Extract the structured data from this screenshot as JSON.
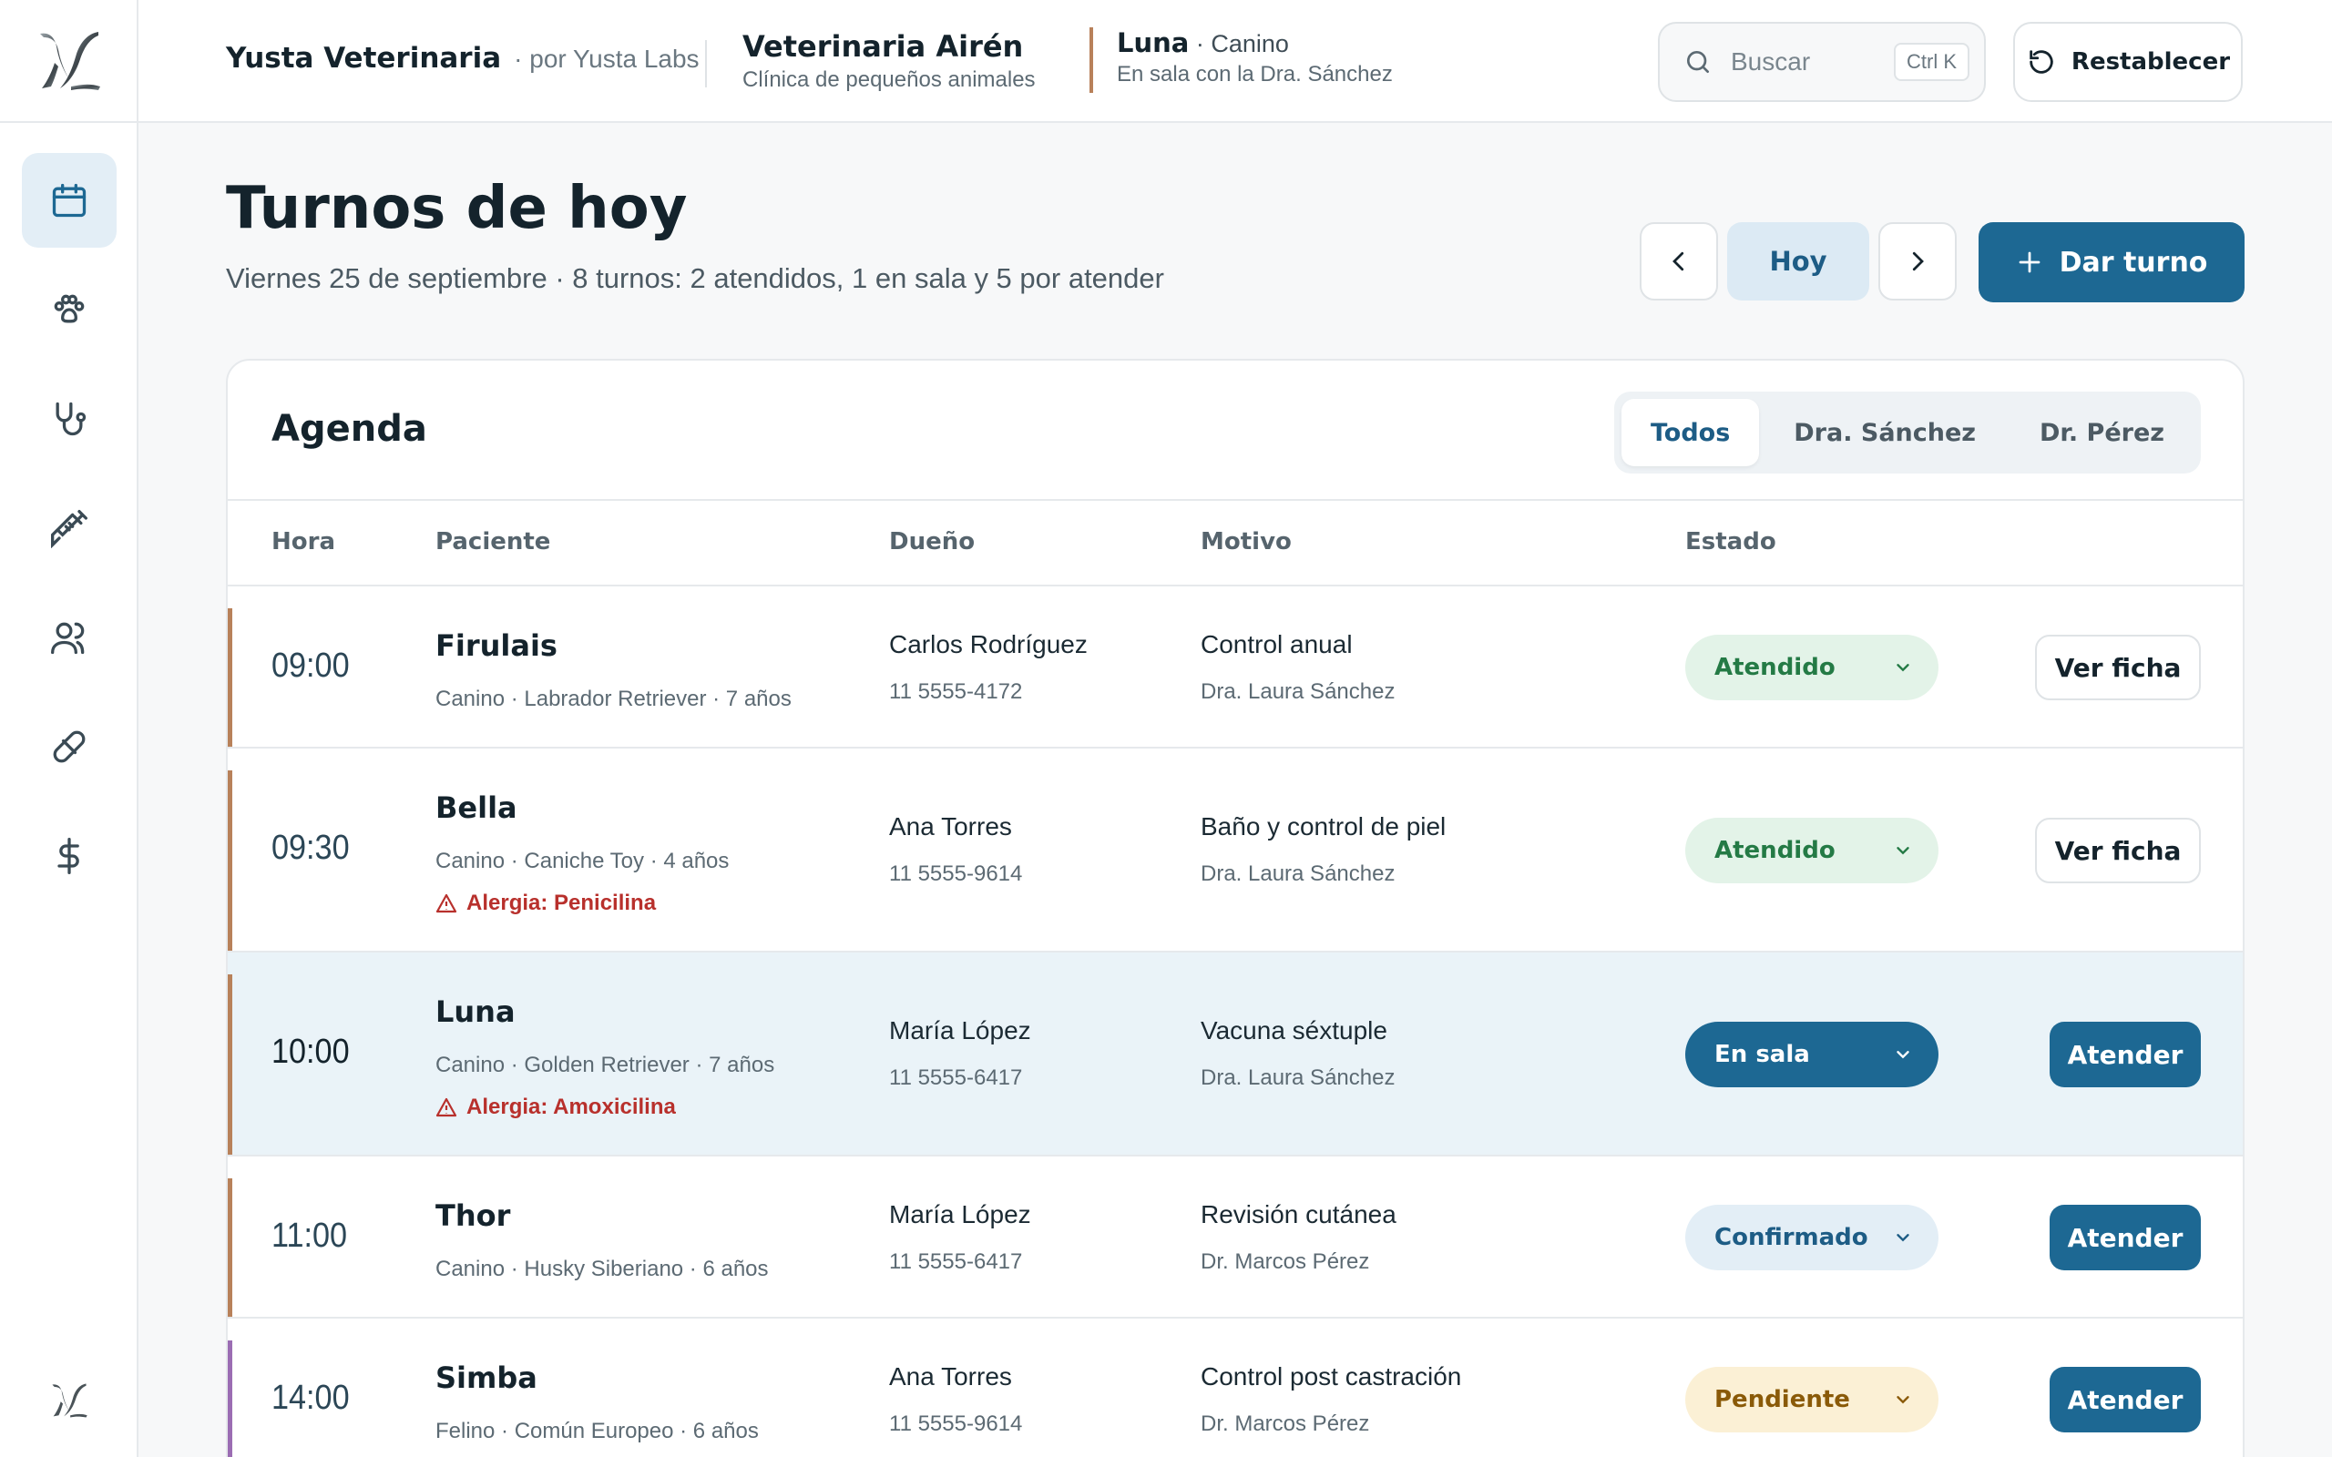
{
  "brand": {
    "name": "Yusta Veterinaria",
    "by": "· por Yusta Labs"
  },
  "clinic": {
    "name": "Veterinaria Airén",
    "subtitle": "Clínica de pequeños animales"
  },
  "current_patient": {
    "name": "Luna",
    "species": " · Canino",
    "status": "En sala con la Dra. Sánchez"
  },
  "search": {
    "placeholder": "Buscar",
    "shortcut": "Ctrl K"
  },
  "reset_label": "Restablecer",
  "sidebar": {
    "items": [
      {
        "icon": "calendar-icon",
        "active": true
      },
      {
        "icon": "paw-icon",
        "active": false
      },
      {
        "icon": "stethoscope-icon",
        "active": false
      },
      {
        "icon": "syringe-icon",
        "active": false
      },
      {
        "icon": "users-icon",
        "active": false
      },
      {
        "icon": "pill-icon",
        "active": false
      },
      {
        "icon": "dollar-icon",
        "active": false
      }
    ]
  },
  "page": {
    "title": "Turnos de hoy",
    "subtitle": "Viernes 25 de septiembre · 8 turnos: 2 atendidos, 1 en sala y 5 por atender",
    "today_label": "Hoy",
    "new_label": "Dar turno"
  },
  "agenda": {
    "title": "Agenda",
    "filters": [
      "Todos",
      "Dra. Sánchez",
      "Dr. Pérez"
    ],
    "active_filter": "Todos",
    "columns": [
      "Hora",
      "Paciente",
      "Dueño",
      "Motivo",
      "Estado"
    ],
    "rows": [
      {
        "time": "09:00",
        "patient": "Firulais",
        "detail": "Canino · Labrador Retriever · 7 años",
        "allergy": "",
        "owner": "Carlos Rodríguez",
        "phone": "11 5555-4172",
        "reason": "Control anual",
        "vet": "Dra. Laura Sánchez",
        "status": "Atendido",
        "action": "Ver ficha"
      },
      {
        "time": "09:30",
        "patient": "Bella",
        "detail": "Canino · Caniche Toy · 4 años",
        "allergy": "Alergia: Penicilina",
        "owner": "Ana Torres",
        "phone": "11 5555-9614",
        "reason": "Baño y control de piel",
        "vet": "Dra. Laura Sánchez",
        "status": "Atendido",
        "action": "Ver ficha"
      },
      {
        "time": "10:00",
        "patient": "Luna",
        "detail": "Canino · Golden Retriever · 7 años",
        "allergy": "Alergia: Amoxicilina",
        "owner": "María López",
        "phone": "11 5555-6417",
        "reason": "Vacuna séxtuple",
        "vet": "Dra. Laura Sánchez",
        "status": "En sala",
        "action": "Atender"
      },
      {
        "time": "11:00",
        "patient": "Thor",
        "detail": "Canino · Husky Siberiano · 6 años",
        "allergy": "",
        "owner": "María López",
        "phone": "11 5555-6417",
        "reason": "Revisión cutánea",
        "vet": "Dr. Marcos Pérez",
        "status": "Confirmado",
        "action": "Atender"
      },
      {
        "time": "14:00",
        "patient": "Simba",
        "detail": "Felino · Común Europeo · 6 años",
        "allergy": "",
        "owner": "Ana Torres",
        "phone": "11 5555-9614",
        "reason": "Control post castración",
        "vet": "Dr. Marcos Pérez",
        "status": "Pendiente",
        "action": "Atender"
      }
    ]
  },
  "colors": {
    "primary": "#1d6893",
    "canine_accent": "#b8815a",
    "feline_accent": "#9b6db3",
    "attended": "#247a45",
    "pending": "#8a5a08",
    "allergy": "#b8302c"
  }
}
